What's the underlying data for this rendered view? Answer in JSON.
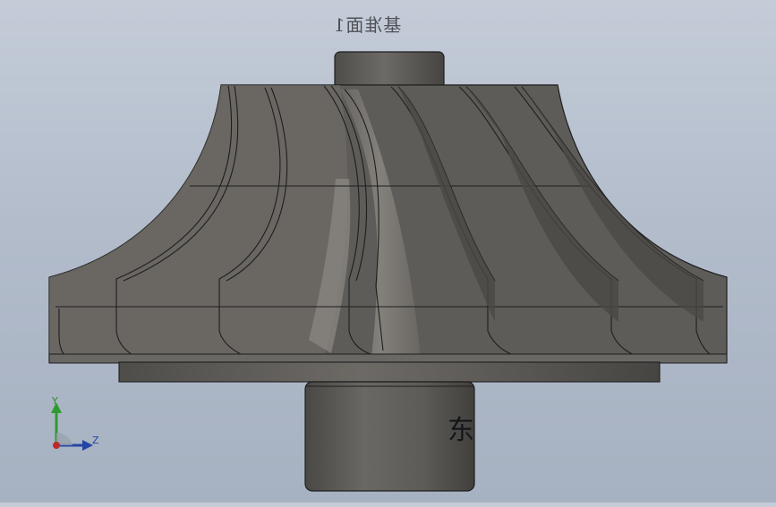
{
  "viewport": {
    "background_top": "#c4ccd8",
    "background_bottom": "#a6b1c1",
    "part_color": "#5c5a56",
    "edge_color": "#1e1e1e"
  },
  "annotations": {
    "top_text": "基准面1",
    "shaft_text": "东軸"
  },
  "triad": {
    "y_label": "Y",
    "z_label": "Z",
    "y_color": "#2f9a2f",
    "z_color": "#2346a6",
    "origin_color": "#c0282a"
  }
}
